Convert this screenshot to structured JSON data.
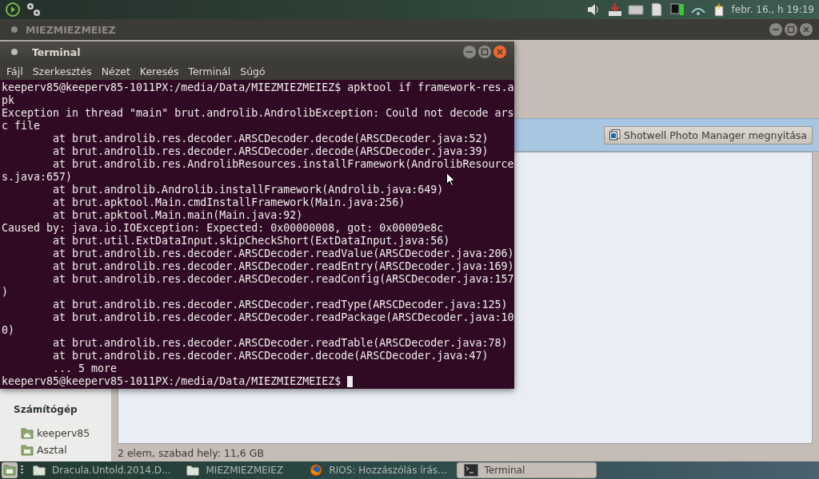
{
  "top_panel": {
    "clock": "febr. 16., h 19:19"
  },
  "file_manager": {
    "title": "MIEZMIEZMEIEZ",
    "open_button": "Shotwell Photo Manager megnyitása",
    "sidebar": {
      "heading": "Számítógép",
      "items": [
        {
          "label": "keeperv85",
          "kind": "home"
        },
        {
          "label": "Asztal",
          "kind": "desktop"
        }
      ]
    },
    "status": "2 elem, szabad hely: 11,6 GB"
  },
  "terminal": {
    "title": "Terminal",
    "menu": [
      "Fájl",
      "Szerkesztés",
      "Nézet",
      "Keresés",
      "Terminál",
      "Súgó"
    ],
    "lines": [
      {
        "text": "keeperv85@keeperv85-1011PX:/media/Data/MIEZMIEZMEIEZ$ apktool if framework-res.a",
        "indent": false
      },
      {
        "text": "pk",
        "indent": false
      },
      {
        "text": "Exception in thread \"main\" brut.androlib.AndrolibException: Could not decode ars",
        "indent": false
      },
      {
        "text": "c file",
        "indent": false
      },
      {
        "text": "at brut.androlib.res.decoder.ARSCDecoder.decode(ARSCDecoder.java:52)",
        "indent": true
      },
      {
        "text": "at brut.androlib.res.decoder.ARSCDecoder.decode(ARSCDecoder.java:39)",
        "indent": true
      },
      {
        "text": "at brut.androlib.res.AndrolibResources.installFramework(AndrolibResource",
        "indent": true
      },
      {
        "text": "s.java:657)",
        "indent": false
      },
      {
        "text": "at brut.androlib.Androlib.installFramework(Androlib.java:649)",
        "indent": true
      },
      {
        "text": "at brut.apktool.Main.cmdInstallFramework(Main.java:256)",
        "indent": true
      },
      {
        "text": "at brut.apktool.Main.main(Main.java:92)",
        "indent": true
      },
      {
        "text": "Caused by: java.io.IOException: Expected: 0x00000008, got: 0x00009e8c",
        "indent": false
      },
      {
        "text": "at brut.util.ExtDataInput.skipCheckShort(ExtDataInput.java:56)",
        "indent": true
      },
      {
        "text": "at brut.androlib.res.decoder.ARSCDecoder.readValue(ARSCDecoder.java:206)",
        "indent": true
      },
      {
        "text": "at brut.androlib.res.decoder.ARSCDecoder.readEntry(ARSCDecoder.java:169)",
        "indent": true
      },
      {
        "text": "at brut.androlib.res.decoder.ARSCDecoder.readConfig(ARSCDecoder.java:157",
        "indent": true
      },
      {
        "text": ")",
        "indent": false
      },
      {
        "text": "at brut.androlib.res.decoder.ARSCDecoder.readType(ARSCDecoder.java:125)",
        "indent": true
      },
      {
        "text": "at brut.androlib.res.decoder.ARSCDecoder.readPackage(ARSCDecoder.java:10",
        "indent": true
      },
      {
        "text": "0)",
        "indent": false
      },
      {
        "text": "at brut.androlib.res.decoder.ARSCDecoder.readTable(ARSCDecoder.java:78)",
        "indent": true
      },
      {
        "text": "at brut.androlib.res.decoder.ARSCDecoder.decode(ARSCDecoder.java:47)",
        "indent": true
      },
      {
        "text": "... 5 more",
        "indent": true
      },
      {
        "text": "keeperv85@keeperv85-1011PX:/media/Data/MIEZMIEZMEIEZ$",
        "indent": false
      }
    ]
  },
  "taskbar": {
    "items": [
      {
        "label": "Dracula.Untold.2014.D...",
        "kind": "folder",
        "selected": false
      },
      {
        "label": "MIEZMIEZMEIEZ",
        "kind": "folder",
        "selected": false
      },
      {
        "label": "RIOS: Hozzászólás írás...",
        "kind": "browser",
        "selected": false
      },
      {
        "label": "Terminal",
        "kind": "terminal",
        "selected": true
      }
    ]
  }
}
